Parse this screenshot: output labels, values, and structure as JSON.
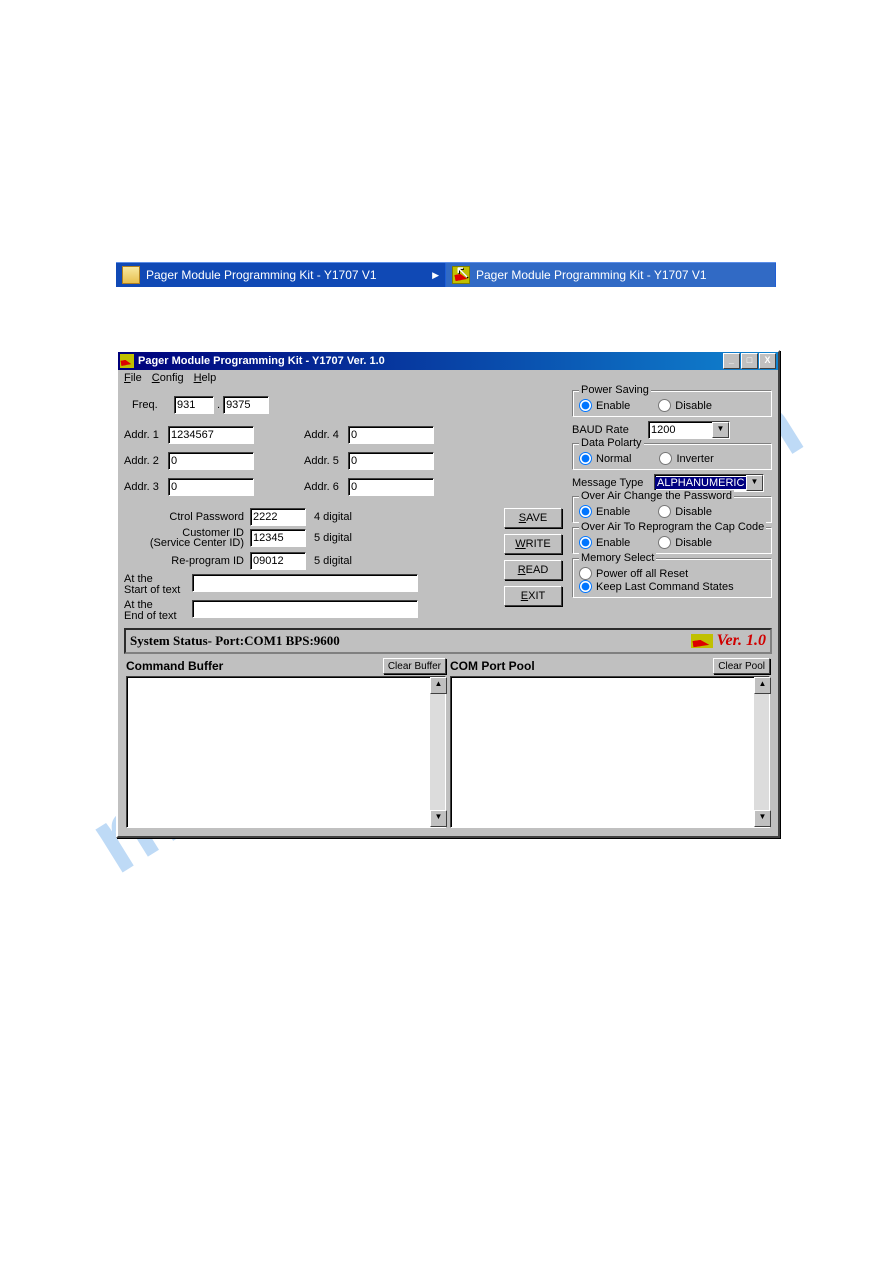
{
  "watermark": "manualslive.com",
  "taskbar": {
    "items": [
      {
        "label": "Pager Module Programming Kit - Y1707 V1",
        "arrow": "▶"
      },
      {
        "label": "Pager Module Programming Kit - Y1707 V1",
        "arrow": ""
      }
    ]
  },
  "window": {
    "title": "Pager Module Programming Kit - Y1707 Ver. 1.0",
    "controls": {
      "min": "_",
      "max": "□",
      "close": "X"
    },
    "menu": {
      "file": "File",
      "config": "Config",
      "help": "Help"
    }
  },
  "freq": {
    "label": "Freq.",
    "major": "931",
    "dot": ".",
    "minor": "9375"
  },
  "addr": {
    "l1": "Addr. 1",
    "v1": "1234567",
    "l2": "Addr. 2",
    "v2": "0",
    "l3": "Addr. 3",
    "v3": "0",
    "l4": "Addr. 4",
    "v4": "0",
    "l5": "Addr. 5",
    "v5": "0",
    "l6": "Addr. 6",
    "v6": "0"
  },
  "ids": {
    "ctrlpw_label": "Ctrol Password",
    "ctrlpw": "2222",
    "ctrlpw_hint": "4 digital",
    "custid_label_a": "Customer ID",
    "custid_label_b": "(Service Center ID)",
    "custid": "12345",
    "custid_hint": "5 digital",
    "reprog_label": "Re-program ID",
    "reprog": "09012",
    "reprog_hint": "5 digital"
  },
  "texts": {
    "start_label_a": "At the",
    "start_label_b": "Start of text",
    "start_val": "",
    "end_label_a": "At the",
    "end_label_b": "End of text",
    "end_val": ""
  },
  "actions": {
    "save": "SAVE",
    "write": "WRITE",
    "read": "READ",
    "exit": "EXIT"
  },
  "power_saving": {
    "title": "Power Saving",
    "opt1": "Enable",
    "opt2": "Disable",
    "selected": "Enable"
  },
  "baud": {
    "label": "BAUD Rate",
    "value": "1200"
  },
  "polarity": {
    "title": "Data Polarty",
    "opt1": "Normal",
    "opt2": "Inverter",
    "selected": "Normal"
  },
  "msg_type": {
    "label": "Message Type",
    "value": "ALPHANUMERIC"
  },
  "ota_pw": {
    "title": "Over Air Change the Password",
    "opt1": "Enable",
    "opt2": "Disable",
    "selected": "Enable"
  },
  "ota_cap": {
    "title": "Over Air To Reprogram the Cap Code",
    "opt1": "Enable",
    "opt2": "Disable",
    "selected": "Enable"
  },
  "memory": {
    "title": "Memory Select",
    "opt1": "Power off all Reset",
    "opt2": "Keep Last Command States",
    "selected": "Keep Last Command States"
  },
  "status": {
    "text": "System Status- Port:COM1 BPS:9600",
    "version": "Ver. 1.0"
  },
  "panels": {
    "left": {
      "title": "Command Buffer",
      "clear": "Clear Buffer"
    },
    "right": {
      "title": "COM Port Pool",
      "clear": "Clear Pool"
    }
  }
}
